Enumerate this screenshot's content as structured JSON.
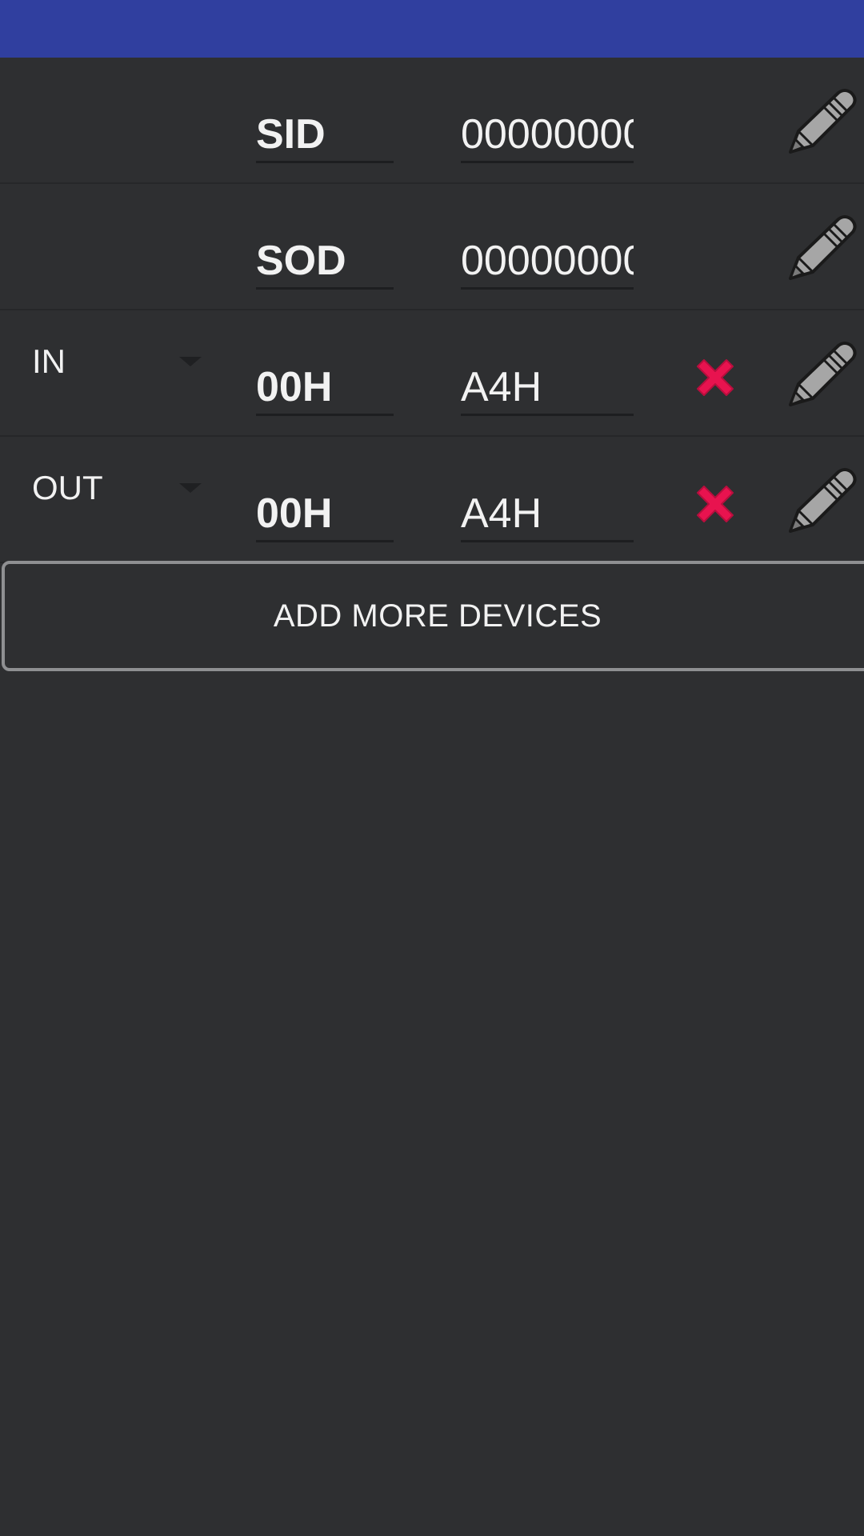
{
  "colors": {
    "status_bar": "#303f9f",
    "background": "#2e2f31",
    "delete_red": "#e8134f",
    "pencil_gray": "#a6a6a6"
  },
  "rows": [
    {
      "type": "",
      "field_a": "SID",
      "field_b": "00000000",
      "has_delete": false,
      "edit_icon": "pencil-icon"
    },
    {
      "type": "",
      "field_a": "SOD",
      "field_b": "00000000",
      "has_delete": false,
      "edit_icon": "pencil-icon"
    },
    {
      "type": "IN",
      "field_a": "00H",
      "field_b": "A4H",
      "has_delete": true,
      "delete_icon": "close-x-icon",
      "edit_icon": "pencil-icon"
    },
    {
      "type": "OUT",
      "field_a": "00H",
      "field_b": "A4H",
      "has_delete": true,
      "delete_icon": "close-x-icon",
      "edit_icon": "pencil-icon"
    }
  ],
  "add_button": {
    "label": "ADD MORE DEVICES"
  }
}
